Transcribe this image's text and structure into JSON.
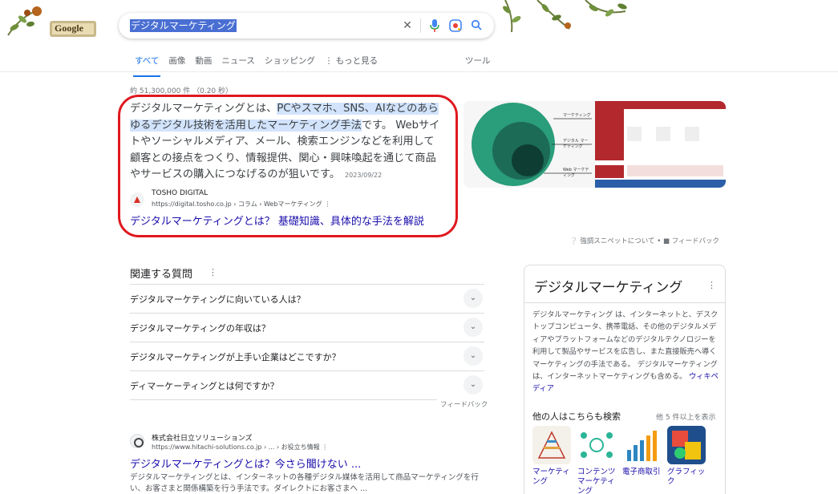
{
  "header": {
    "logo_text": "Google",
    "search_value": "デジタルマーケティング",
    "icons": [
      "clear-icon",
      "mic-icon",
      "lens-icon",
      "search-icon"
    ]
  },
  "tabs": [
    {
      "label": "すべて",
      "active": true
    },
    {
      "label": "画像"
    },
    {
      "label": "動画"
    },
    {
      "label": "ニュース"
    },
    {
      "label": "ショッピング"
    },
    {
      "label": "⋮ もっと見る"
    }
  ],
  "tools_label": "ツール",
  "result_count": "約 51,300,000 件 （0.20 秒）",
  "snippet": {
    "text_plain_start": "デジタルマーケティングとは、",
    "text_highlight": "PCやスマホ、SNS、AIなどのあらゆるデジタル技術を活用したマーケティング手法",
    "text_plain_end": "です。 Webサイトやソーシャルメディア、メール、検索エンジンなどを利用して顧客との接点をつくり、情報提供、関心・興味喚起を通じて商品やサービスの購入につなげるのが狙いです。",
    "date": "2023/09/22",
    "source_name": "TOSHO DIGITAL",
    "source_url": "https://digital.tosho.co.jp › コラム › Webマーケティング  ⋮",
    "link_title": "デジタルマーケティングとは？ 基礎知識、具体的な手法を解説",
    "footer": "❔ 強調スニペットについて  •  ■ フィードバック",
    "image_labels": [
      "マーケティング",
      "デジタル マーケティング",
      "Web マーケティング"
    ]
  },
  "paa": {
    "title": "関連する質問",
    "questions": [
      "デジタルマーケティングに向いている人は？",
      "デジタルマーケティングの年収は？",
      "デジタルマーケティングが上手い企業はどこですか？",
      "ディマーケーティングとは何ですか？"
    ],
    "feedback": "フィードバック"
  },
  "result2": {
    "site_name": "株式会社日立ソリューションズ",
    "url": "https://www.hitachi-solutions.co.jp › ... › お役立ち情報  ⋮",
    "title": "デジタルマーケティングとは？今さら聞けない ...",
    "description": "デジタルマーケティングとは、インターネットの各種デジタル媒体を活用して商品マーケティングを行い、お客さまと関係構築を行う手法です。ダイレクトにお客さまへ ..."
  },
  "knowledge_panel": {
    "title": "デジタルマーケティング",
    "description": "デジタルマーケティング は、インターネットと、デスクトップコンピュータ、携帯電話、その他のデジタルメディアやプラットフォームなどのデジタルテクノロジーを利用して製品やサービスを広告し、また直接販売へ導くマーケティングの手法である。 デジタルマーケティングは、インターネットマーケティングも含める。",
    "wiki_link": "ウィキペディア",
    "also_search_title": "他の人はこちらも検索",
    "also_search_more": "他 5 件以上を表示",
    "also_items": [
      "マーケティング",
      "コンテンツマーケティング",
      "電子商取引",
      "グラフィック"
    ]
  },
  "colors": {
    "link": "#1a0dab",
    "accent": "#1a73e8",
    "highlight_ring": "#e0181f",
    "selection": "#4a6fd3"
  }
}
